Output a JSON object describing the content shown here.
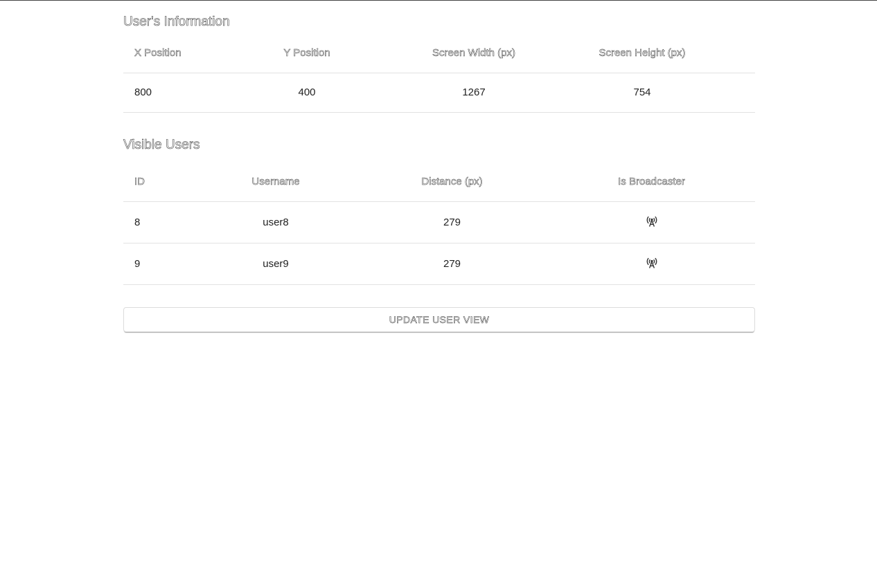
{
  "user_info": {
    "title": "User's Information",
    "headers": [
      "X Position",
      "Y Position",
      "Screen Width (px)",
      "Screen Height (px)"
    ],
    "row": [
      "800",
      "400",
      "1267",
      "754"
    ]
  },
  "visible_users": {
    "title": "Visible Users",
    "headers": [
      "ID",
      "Username",
      "Distance (px)",
      "Is Broadcaster"
    ],
    "rows": [
      {
        "id": "8",
        "username": "user8",
        "distance": "279",
        "broadcaster_icon": "broadcast-tower-icon"
      },
      {
        "id": "9",
        "username": "user9",
        "distance": "279",
        "broadcaster_icon": "broadcast-tower-icon"
      }
    ]
  },
  "actions": {
    "update_label": "UPDATE USER VIEW"
  }
}
